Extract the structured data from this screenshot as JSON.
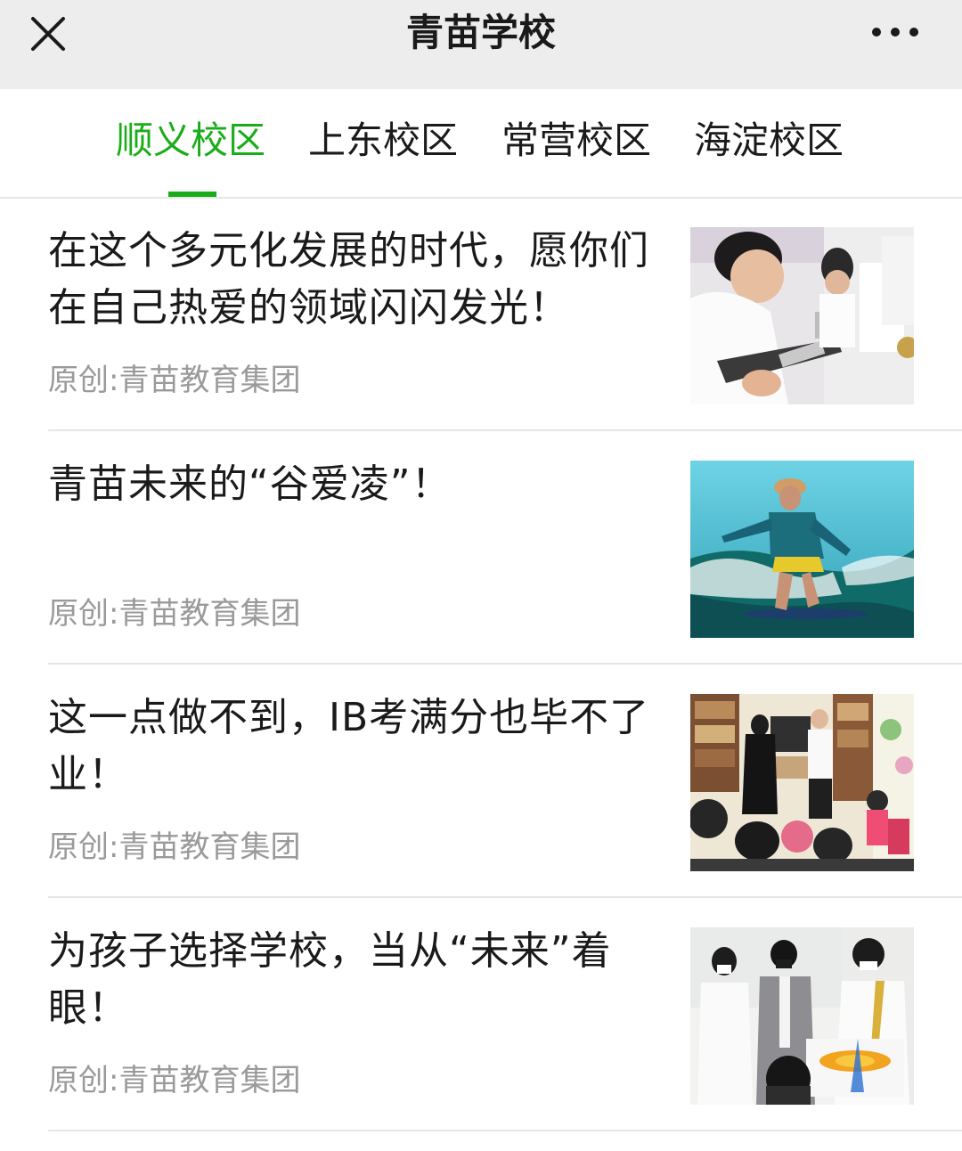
{
  "header": {
    "title": "青苗学校",
    "close_icon": "close-icon",
    "more_icon": "more-dots-icon"
  },
  "tabs": [
    {
      "label": "顺义校区",
      "active": true
    },
    {
      "label": "上东校区",
      "active": false
    },
    {
      "label": "常营校区",
      "active": false
    },
    {
      "label": "海淀校区",
      "active": false
    }
  ],
  "colors": {
    "accent": "#1aad19",
    "source_text": "#9a9a9a",
    "topbar_bg": "#ededed"
  },
  "articles": [
    {
      "title": "在这个多元化发展的时代，愿你们在自己热爱的领域闪闪发光！",
      "source": "原创:青苗教育集团"
    },
    {
      "title": "青苗未来的“谷爱凌”！",
      "source": "原创:青苗教育集团"
    },
    {
      "title": "这一点做不到，IB考满分也毕不了业！",
      "source": "原创:青苗教育集团"
    },
    {
      "title": "为孩子选择学校，当从“未来”着眼！",
      "source": "原创:青苗教育集团"
    }
  ]
}
